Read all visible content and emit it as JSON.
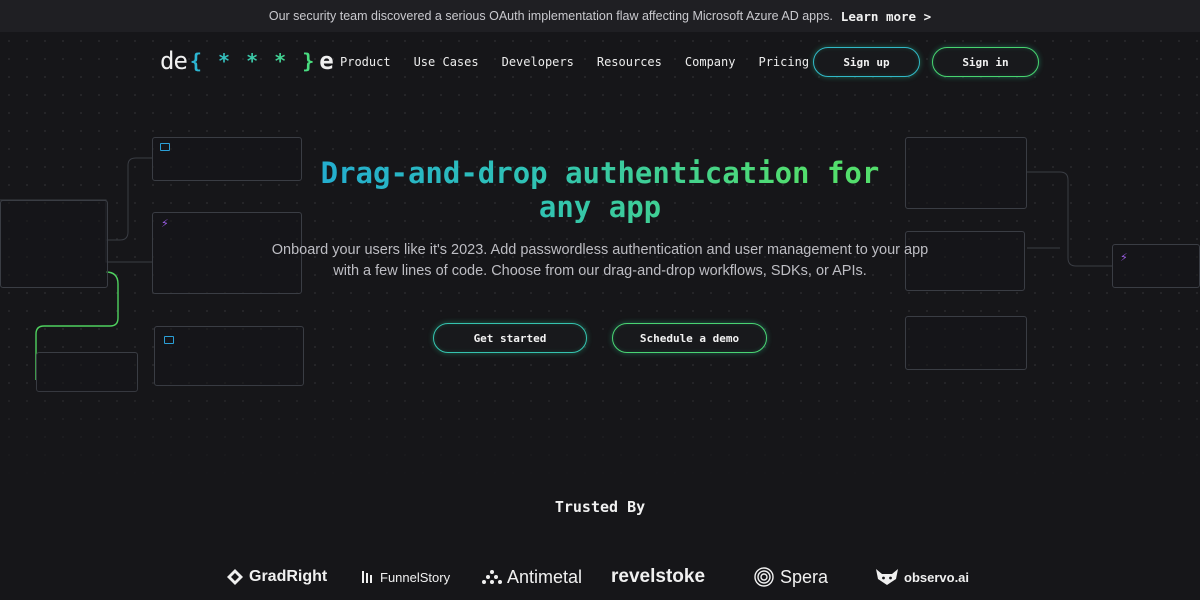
{
  "announcement": {
    "message": "Our security team discovered a serious OAuth implementation flaw affecting Microsoft Azure AD apps.",
    "link_label": "Learn more >"
  },
  "header": {
    "logo": {
      "start": "de",
      "middle": "{ * * * }",
      "end": "e"
    },
    "nav": [
      "Product",
      "Use Cases",
      "Developers",
      "Resources",
      "Company",
      "Pricing"
    ],
    "signup_label": "Sign up",
    "signin_label": "Sign in"
  },
  "hero": {
    "title_line1": "Drag-and-drop authentication for",
    "title_line2": "any app",
    "subtitle": "Onboard your users like it's 2023. Add passwordless authentication and user management to your app with a few lines of code. Choose from our drag-and-drop workflows, SDKs, or APIs.",
    "cta_primary": "Get started",
    "cta_secondary": "Schedule a demo"
  },
  "trusted": {
    "title": "Trusted By",
    "logos": [
      "GradRight",
      "FunnelStory",
      "Antimetal",
      "revelstoke",
      "Spera",
      "observo.ai"
    ]
  },
  "colors": {
    "background": "#161619",
    "announcement_bg": "#1f1f23",
    "gradient_start": "#20a7d8",
    "gradient_end": "#53de6c",
    "bolt": "#9b5de5",
    "monitor": "#2b9fd6"
  },
  "icons": [
    "monitor-icon",
    "bolt-icon",
    "chevron-right-icon"
  ]
}
